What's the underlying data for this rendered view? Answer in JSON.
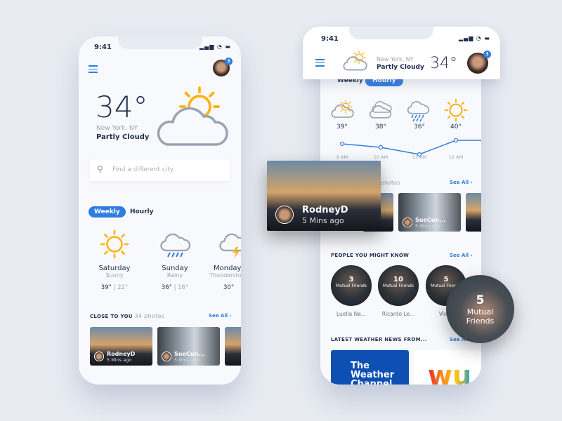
{
  "colors": {
    "accent": "#2f7de1",
    "sun": "#fbb318",
    "cloud": "#9aa3b2"
  },
  "status_time": "9:41",
  "left": {
    "badge": "3",
    "temp": "34°",
    "location": "New York, NY",
    "condition": "Partly Cloudy",
    "search_placeholder": "Find a different city",
    "tabs": [
      "Weekly",
      "Hourly"
    ],
    "days": [
      {
        "day": "Saturday",
        "cond": "Sunny",
        "hi": "39°",
        "lo": "22°",
        "icon": "sun-icon"
      },
      {
        "day": "Sunday",
        "cond": "Rainy",
        "hi": "36°",
        "lo": "16°",
        "icon": "rain-cloud-icon"
      },
      {
        "day": "Monday",
        "cond": "Thunderstorm",
        "hi": "30°",
        "lo": "",
        "icon": "thunder-cloud-icon"
      }
    ],
    "close_title": "CLOSE TO YOU",
    "close_count": "34 photos",
    "see_all": "See All",
    "photos": [
      {
        "name": "RodneyD",
        "time": "5 Mins ago"
      },
      {
        "name": "SueCun...",
        "time": "5 Mins ago"
      }
    ]
  },
  "right": {
    "badge": "3",
    "location": "New York, NY",
    "condition": "Partly Cloudy",
    "temp": "34°",
    "tabs": [
      "Weekly",
      "Hourly"
    ],
    "hourly": [
      {
        "temp": "39°",
        "time": "9 AM",
        "icon": "partly-cloudy-icon"
      },
      {
        "temp": "38°",
        "time": "10 AM",
        "icon": "cloud-icon"
      },
      {
        "temp": "36°",
        "time": "11 AM",
        "icon": "rain-cloud-icon"
      },
      {
        "temp": "40°",
        "time": "12 AM",
        "icon": "sun-icon"
      }
    ],
    "photos_label": "photos",
    "see_all": "See All",
    "photos": [
      {
        "name": "SueCun...",
        "time": "5 Mins ago"
      }
    ],
    "people_title": "PEOPLE YOU MIGHT KNOW",
    "people": [
      {
        "count": "3",
        "label": "Mutual Friends",
        "name": "Luella Ne..."
      },
      {
        "count": "10",
        "label": "Mutual Friends",
        "name": "Ricardo Le..."
      },
      {
        "count": "5",
        "label": "Mutual Friends",
        "name": "Viola"
      }
    ],
    "news_title": "LATEST WEATHER NEWS FROM...",
    "news": [
      {
        "logo": "The Weather Channel"
      },
      {
        "logo": "wu"
      }
    ]
  },
  "popup": {
    "name": "RodneyD",
    "time": "5 Mins ago"
  },
  "zoom_friend": {
    "count": "5",
    "label": "Mutual Friends"
  }
}
